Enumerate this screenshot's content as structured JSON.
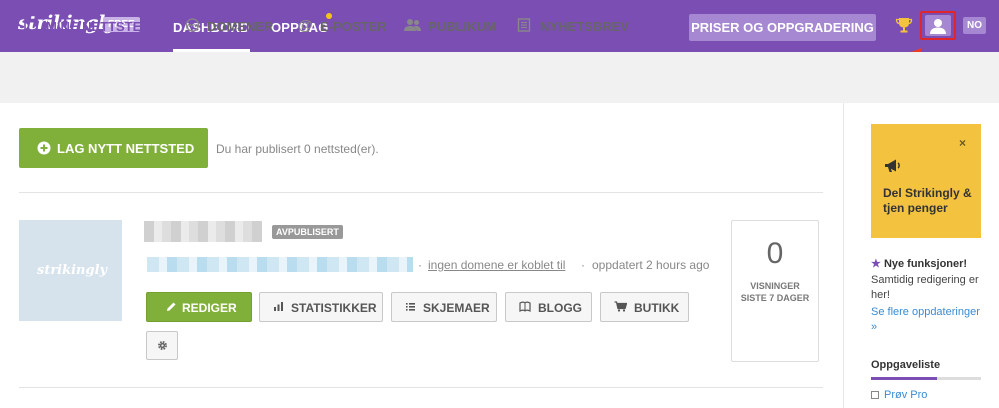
{
  "header": {
    "logo": "strikingly",
    "plan_badge": "FREE",
    "nav": [
      {
        "label": "DASHBORD",
        "active": true
      },
      {
        "label": "OPPDAG",
        "active": false,
        "has_notification": true
      }
    ],
    "pricing_button": "PRISER OG OPPGRADERING",
    "language": "NO"
  },
  "subnav": {
    "items": [
      {
        "label": "MINE NETTSTEDER",
        "icon": "window-icon",
        "active": true
      },
      {
        "label": "DOMENER",
        "icon": "www-icon",
        "active": false
      },
      {
        "label": "E-POSTER",
        "icon": "at-icon",
        "active": false
      },
      {
        "label": "PUBLIKUM",
        "icon": "users-icon",
        "active": false
      },
      {
        "label": "NYHETSBREV",
        "icon": "newsletter-icon",
        "active": false
      }
    ]
  },
  "main": {
    "create_button": "LAG NYTT NETTSTED",
    "published_note": "Du har publisert 0 nettsted(er).",
    "site": {
      "thumbnail_logo": "strikingly",
      "status_badge": "AVPUBLISERT",
      "domain_link": "ingen domene er koblet til",
      "updated": "oppdatert 2 hours ago",
      "actions": {
        "edit": "REDIGER",
        "stats": "STATISTIKKER",
        "forms": "SKJEMAER",
        "blog": "BLOGG",
        "store": "BUTIKK"
      },
      "views": {
        "count": "0",
        "label_line1": "VISNINGER",
        "label_line2": "SISTE 7 DAGER"
      }
    }
  },
  "sidebar": {
    "promo": {
      "close": "×",
      "title": "Del Strikingly & tjen penger"
    },
    "features": {
      "title": "Nye funksjoner!",
      "body": "Samtidig redigering er her!",
      "link": "Se flere oppdateringer »"
    },
    "tasks": {
      "title": "Oppgaveliste",
      "progress": 0.6,
      "items": [
        {
          "label": "Prøv Pro"
        }
      ]
    }
  },
  "colors": {
    "brand_purple": "#7b4eb4",
    "action_green": "#81b03a",
    "promo_yellow": "#f3c33f",
    "highlight_red": "#e0262a"
  }
}
